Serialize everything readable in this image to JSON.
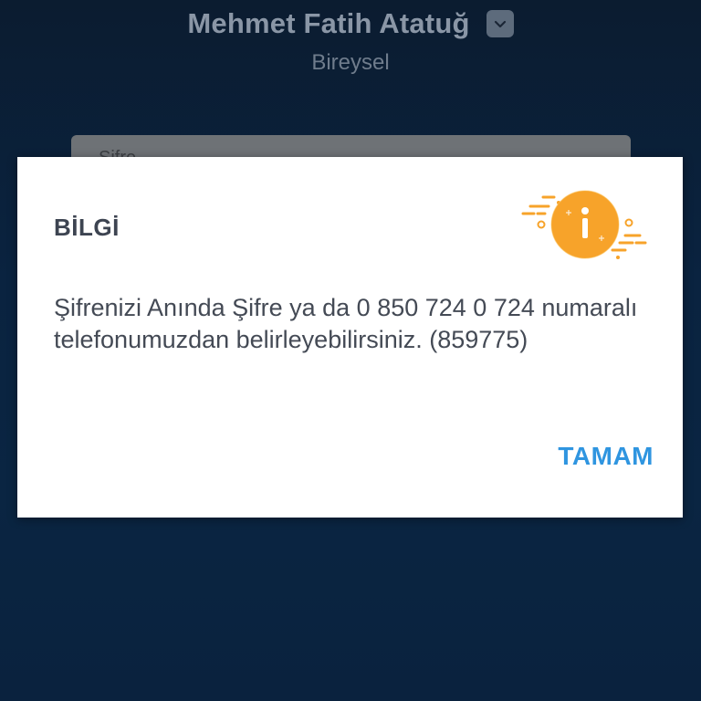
{
  "header": {
    "user_name": "Mehmet Fatih Atatuğ",
    "user_type": "Bireysel",
    "chevron_icon": "chevron-down-icon"
  },
  "background_form": {
    "field_label": "Şifre"
  },
  "dialog": {
    "title": "BİLGİ",
    "icon": "info-icon",
    "message": "Şifrenizi Anında Şifre ya da 0 850 724 0 724 numaralı telefonumuzdan belirleyebilirsiniz. (859775)",
    "ok_label": "TAMAM"
  },
  "colors": {
    "accent": "#2f95e0",
    "info_orange": "#f7a32a",
    "background_dark": "#0a2340"
  }
}
